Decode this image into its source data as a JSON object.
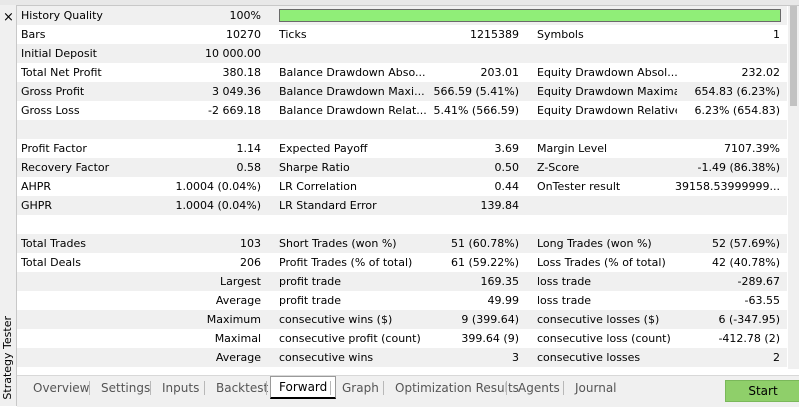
{
  "sidebar": {
    "close_label": "×",
    "title": "Strategy Tester"
  },
  "quality": {
    "label": "History Quality",
    "value": "100%",
    "level": 1.0
  },
  "rows": [
    {
      "c1": [
        "Bars",
        "10270"
      ],
      "c2": [
        "Ticks",
        "1215389"
      ],
      "c3": [
        "Symbols",
        "1"
      ]
    },
    {
      "c1": [
        "Initial Deposit",
        "10 000.00"
      ],
      "c2": [
        "",
        ""
      ],
      "c3": [
        "",
        ""
      ]
    },
    {
      "c1": [
        "Total Net Profit",
        "380.18"
      ],
      "c2": [
        "Balance Drawdown Abso...",
        "203.01"
      ],
      "c3": [
        "Equity Drawdown Absol...",
        "232.02"
      ]
    },
    {
      "c1": [
        "Gross Profit",
        "3 049.36"
      ],
      "c2": [
        "Balance Drawdown Maxi...",
        "566.59 (5.41%)"
      ],
      "c3": [
        "Equity Drawdown Maximal",
        "654.83 (6.23%)"
      ]
    },
    {
      "c1": [
        "Gross Loss",
        "-2 669.18"
      ],
      "c2": [
        "Balance Drawdown Relat...",
        "5.41% (566.59)"
      ],
      "c3": [
        "Equity Drawdown Relative",
        "6.23% (654.83)"
      ]
    },
    {
      "c1": [
        "",
        ""
      ],
      "c2": [
        "",
        ""
      ],
      "c3": [
        "",
        ""
      ]
    },
    {
      "c1": [
        "Profit Factor",
        "1.14"
      ],
      "c2": [
        "Expected Payoff",
        "3.69"
      ],
      "c3": [
        "Margin Level",
        "7107.39%"
      ]
    },
    {
      "c1": [
        "Recovery Factor",
        "0.58"
      ],
      "c2": [
        "Sharpe Ratio",
        "0.50"
      ],
      "c3": [
        "Z-Score",
        "-1.49 (86.38%)"
      ]
    },
    {
      "c1": [
        "AHPR",
        "1.0004 (0.04%)"
      ],
      "c2": [
        "LR Correlation",
        "0.44"
      ],
      "c3": [
        "OnTester result",
        "39158.53999999..."
      ]
    },
    {
      "c1": [
        "GHPR",
        "1.0004 (0.04%)"
      ],
      "c2": [
        "LR Standard Error",
        "139.84"
      ],
      "c3": [
        "",
        ""
      ]
    },
    {
      "c1": [
        "",
        ""
      ],
      "c2": [
        "",
        ""
      ],
      "c3": [
        "",
        ""
      ]
    },
    {
      "c1": [
        "Total Trades",
        "103"
      ],
      "c2": [
        "Short Trades (won %)",
        "51 (60.78%)"
      ],
      "c3": [
        "Long Trades (won %)",
        "52 (57.69%)"
      ]
    },
    {
      "c1": [
        "Total Deals",
        "206"
      ],
      "c2": [
        "Profit Trades (% of total)",
        "61 (59.22%)"
      ],
      "c3": [
        "Loss Trades (% of total)",
        "42 (40.78%)"
      ]
    },
    {
      "c1r": "Largest",
      "c2": [
        "profit trade",
        "169.35"
      ],
      "c3": [
        "loss trade",
        "-289.67"
      ]
    },
    {
      "c1r": "Average",
      "c2": [
        "profit trade",
        "49.99"
      ],
      "c3": [
        "loss trade",
        "-63.55"
      ]
    },
    {
      "c1r": "Maximum",
      "c2": [
        "consecutive wins ($)",
        "9 (399.64)"
      ],
      "c3": [
        "consecutive losses ($)",
        "6 (-347.95)"
      ]
    },
    {
      "c1r": "Maximal",
      "c2": [
        "consecutive profit (count)",
        "399.64 (9)"
      ],
      "c3": [
        "consecutive loss (count)",
        "-412.78 (2)"
      ]
    },
    {
      "c1r": "Average",
      "c2": [
        "consecutive wins",
        "3"
      ],
      "c3": [
        "consecutive losses",
        "2"
      ]
    }
  ],
  "tabs": [
    "Overview",
    "Settings",
    "Inputs",
    "Backtest",
    "Forward",
    "Graph",
    "Optimization Results",
    "Agents",
    "Journal"
  ],
  "active_tab": "Forward",
  "start_label": "Start",
  "colors": {
    "quality_fill": "#90ee78",
    "start_button": "#8fcf6a",
    "row_shade": "#f0f0f0"
  }
}
